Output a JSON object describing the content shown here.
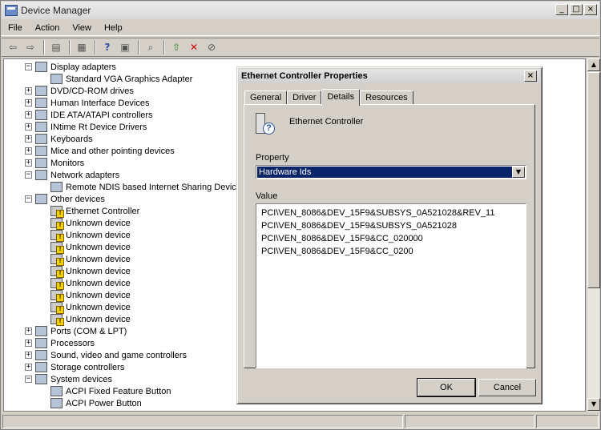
{
  "window": {
    "title": "Device Manager",
    "controls": [
      "_",
      "□",
      "×"
    ]
  },
  "menu": [
    "File",
    "Action",
    "View",
    "Help"
  ],
  "toolbar_icons": [
    "back-icon",
    "forward-icon",
    "console-tree-icon",
    "properties-icon",
    "help-icon",
    "export-icon",
    "scan-icon",
    "update-driver-icon",
    "uninstall-icon",
    "disable-icon"
  ],
  "tree": [
    {
      "label": "Display adapters",
      "level": 0,
      "expander": "−",
      "icon": "display-adapter-icon",
      "warn": false
    },
    {
      "label": "Standard VGA Graphics Adapter",
      "level": 1,
      "expander": "",
      "icon": "display-adapter-icon",
      "warn": false
    },
    {
      "label": "DVD/CD-ROM drives",
      "level": 0,
      "expander": "+",
      "icon": "dvd-drive-icon",
      "warn": false
    },
    {
      "label": "Human Interface Devices",
      "level": 0,
      "expander": "+",
      "icon": "hid-icon",
      "warn": false
    },
    {
      "label": "IDE ATA/ATAPI controllers",
      "level": 0,
      "expander": "+",
      "icon": "ide-controller-icon",
      "warn": false
    },
    {
      "label": "INtime Rt Device Drivers",
      "level": 0,
      "expander": "+",
      "icon": "rt-driver-icon",
      "warn": false
    },
    {
      "label": "Keyboards",
      "level": 0,
      "expander": "+",
      "icon": "keyboard-icon",
      "warn": false
    },
    {
      "label": "Mice and other pointing devices",
      "level": 0,
      "expander": "+",
      "icon": "mouse-icon",
      "warn": false
    },
    {
      "label": "Monitors",
      "level": 0,
      "expander": "+",
      "icon": "monitor-icon",
      "warn": false
    },
    {
      "label": "Network adapters",
      "level": 0,
      "expander": "−",
      "icon": "network-adapter-icon",
      "warn": false
    },
    {
      "label": "Remote NDIS based Internet Sharing Device",
      "level": 1,
      "expander": "",
      "icon": "network-adapter-icon",
      "warn": false
    },
    {
      "label": "Other devices",
      "level": 0,
      "expander": "−",
      "icon": "other-devices-icon",
      "warn": false
    },
    {
      "label": "Ethernet Controller",
      "level": 1,
      "expander": "",
      "icon": "warning-device-icon",
      "warn": true
    },
    {
      "label": "Unknown device",
      "level": 1,
      "expander": "",
      "icon": "warning-device-icon",
      "warn": true
    },
    {
      "label": "Unknown device",
      "level": 1,
      "expander": "",
      "icon": "warning-device-icon",
      "warn": true
    },
    {
      "label": "Unknown device",
      "level": 1,
      "expander": "",
      "icon": "warning-device-icon",
      "warn": true
    },
    {
      "label": "Unknown device",
      "level": 1,
      "expander": "",
      "icon": "warning-device-icon",
      "warn": true
    },
    {
      "label": "Unknown device",
      "level": 1,
      "expander": "",
      "icon": "warning-device-icon",
      "warn": true
    },
    {
      "label": "Unknown device",
      "level": 1,
      "expander": "",
      "icon": "warning-device-icon",
      "warn": true
    },
    {
      "label": "Unknown device",
      "level": 1,
      "expander": "",
      "icon": "warning-device-icon",
      "warn": true
    },
    {
      "label": "Unknown device",
      "level": 1,
      "expander": "",
      "icon": "warning-device-icon",
      "warn": true
    },
    {
      "label": "Unknown device",
      "level": 1,
      "expander": "",
      "icon": "warning-device-icon",
      "warn": true
    },
    {
      "label": "Ports (COM & LPT)",
      "level": 0,
      "expander": "+",
      "icon": "ports-icon",
      "warn": false
    },
    {
      "label": "Processors",
      "level": 0,
      "expander": "+",
      "icon": "processor-icon",
      "warn": false
    },
    {
      "label": "Sound, video and game controllers",
      "level": 0,
      "expander": "+",
      "icon": "sound-icon",
      "warn": false
    },
    {
      "label": "Storage controllers",
      "level": 0,
      "expander": "+",
      "icon": "storage-icon",
      "warn": false
    },
    {
      "label": "System devices",
      "level": 0,
      "expander": "−",
      "icon": "system-devices-icon",
      "warn": false
    },
    {
      "label": "ACPI Fixed Feature Button",
      "level": 1,
      "expander": "",
      "icon": "system-devices-icon",
      "warn": false
    },
    {
      "label": "ACPI Power Button",
      "level": 1,
      "expander": "",
      "icon": "system-devices-icon",
      "warn": false
    }
  ],
  "dialog": {
    "title": "Ethernet Controller Properties",
    "close": "×",
    "tabs": [
      "General",
      "Driver",
      "Details",
      "Resources"
    ],
    "active_tab": "Details",
    "device_name": "Ethernet Controller",
    "property_label": "Property",
    "property_selected": "Hardware Ids",
    "value_label": "Value",
    "values": [
      "PCI\\VEN_8086&DEV_15F9&SUBSYS_0A521028&REV_11",
      "PCI\\VEN_8086&DEV_15F9&SUBSYS_0A521028",
      "PCI\\VEN_8086&DEV_15F9&CC_020000",
      "PCI\\VEN_8086&DEV_15F9&CC_0200"
    ],
    "ok_label": "OK",
    "cancel_label": "Cancel"
  }
}
